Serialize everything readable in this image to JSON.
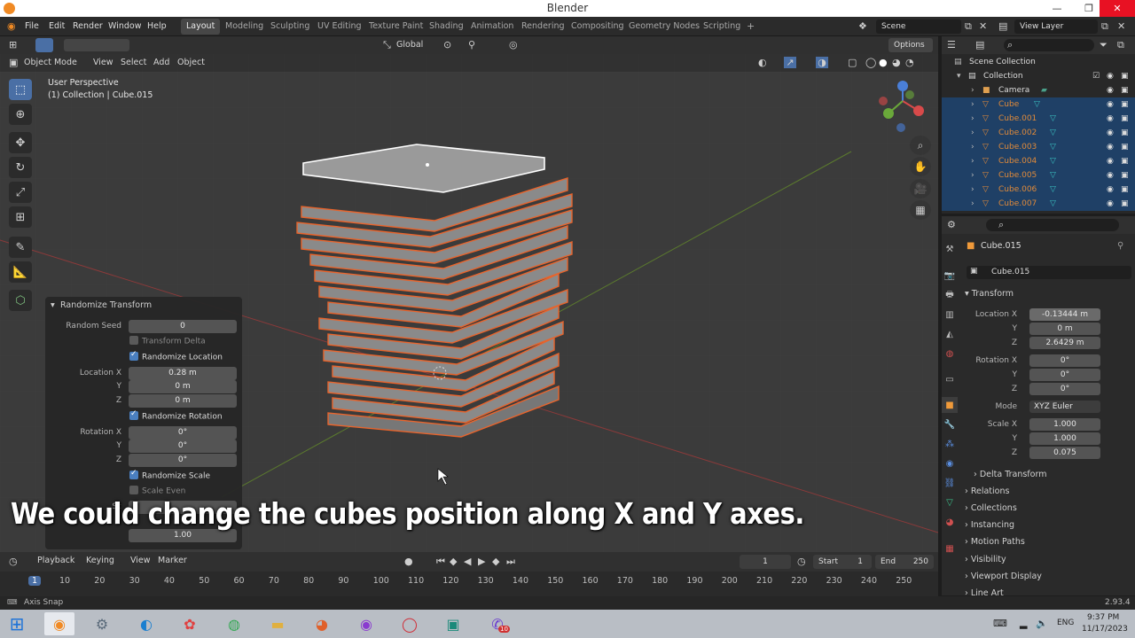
{
  "window": {
    "title": "Blender",
    "minimize": "—",
    "restore": "❐",
    "close": "✕"
  },
  "menu": {
    "file": "File",
    "edit": "Edit",
    "render": "Render",
    "window": "Window",
    "help": "Help"
  },
  "workspaces": [
    "Layout",
    "Modeling",
    "Sculpting",
    "UV Editing",
    "Texture Paint",
    "Shading",
    "Animation",
    "Rendering",
    "Compositing",
    "Geometry Nodes",
    "Scripting"
  ],
  "scene": {
    "name": "Scene",
    "view_layer": "View Layer"
  },
  "viewport_header": {
    "mode": "Object Mode",
    "view": "View",
    "select": "Select",
    "add": "Add",
    "object": "Object",
    "transform_orientation": "Global",
    "options": "Options"
  },
  "viewport_overlay": {
    "perspective": "User Perspective",
    "collection_info": "(1) Collection | Cube.015"
  },
  "redo_panel": {
    "title": "Randomize Transform",
    "random_seed_label": "Random Seed",
    "random_seed": "0",
    "transform_delta": "Transform Delta",
    "randomize_location": "Randomize Location",
    "location_x_label": "Location X",
    "location_x": "0.28 m",
    "y_label": "Y",
    "location_y": "0 m",
    "z_label": "Z",
    "location_z": "0 m",
    "randomize_rotation": "Randomize Rotation",
    "rotation_x_label": "Rotation X",
    "rotation_x": "0°",
    "rotation_y": "0°",
    "rotation_z": "0°",
    "randomize_scale": "Randomize Scale",
    "scale_even": "Scale Even",
    "scale_label": "Sc",
    "scale_value": "1.00"
  },
  "caption": "We could change the  cubes position along X and Y axes.",
  "outliner": {
    "scene_collection": "Scene Collection",
    "collection": "Collection",
    "items": [
      "Camera",
      "Cube",
      "Cube.001",
      "Cube.002",
      "Cube.003",
      "Cube.004",
      "Cube.005",
      "Cube.006",
      "Cube.007"
    ]
  },
  "properties": {
    "object_name": "Cube.015",
    "data_name": "Cube.015",
    "transform": "Transform",
    "location_x_label": "Location X",
    "location_x": "-0.13444 m",
    "y_label": "Y",
    "location_y": "0 m",
    "z_label": "Z",
    "location_z": "2.6429 m",
    "rotation_x_label": "Rotation X",
    "rotation_x": "0°",
    "rotation_y": "0°",
    "rotation_z": "0°",
    "mode_label": "Mode",
    "mode": "XYZ Euler",
    "scale_x_label": "Scale X",
    "scale_x": "1.000",
    "scale_y": "1.000",
    "scale_z": "0.075",
    "sections": [
      "Delta Transform",
      "Relations",
      "Collections",
      "Instancing",
      "Motion Paths",
      "Visibility",
      "Viewport Display",
      "Line Art"
    ]
  },
  "timeline": {
    "playback": "Playback",
    "keying": "Keying",
    "view": "View",
    "marker": "Marker",
    "current_frame": "1",
    "start_label": "Start",
    "start": "1",
    "end_label": "End",
    "end": "250",
    "ticks": [
      "1",
      "10",
      "20",
      "30",
      "40",
      "50",
      "60",
      "70",
      "80",
      "90",
      "100",
      "110",
      "120",
      "130",
      "140",
      "150",
      "160",
      "170",
      "180",
      "190",
      "200",
      "210",
      "220",
      "230",
      "240",
      "250"
    ]
  },
  "status": {
    "left": "Axis Snap",
    "version": "2.93.4"
  },
  "taskbar": {
    "lang": "ENG",
    "time": "9:37 PM",
    "date": "11/17/2023",
    "badge": "10"
  }
}
